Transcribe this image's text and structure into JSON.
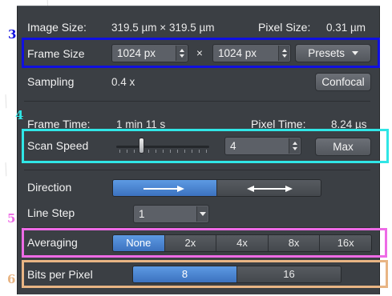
{
  "image_size": {
    "label": "Image Size:",
    "value": "319.5 µm × 319.5 µm"
  },
  "pixel_size": {
    "label": "Pixel Size:",
    "value": "0.31 µm"
  },
  "frame_size": {
    "label": "Frame Size",
    "width": "1024 px",
    "times": "×",
    "height": "1024 px",
    "presets_label": "Presets"
  },
  "sampling": {
    "label": "Sampling",
    "value": "0.4 x",
    "confocal_label": "Confocal"
  },
  "frame_time": {
    "label": "Frame Time:",
    "value": "1 min 11 s"
  },
  "pixel_time": {
    "label": "Pixel Time:",
    "value": "8.24 µs"
  },
  "scan_speed": {
    "label": "Scan Speed",
    "value": "4",
    "max_label": "Max",
    "slider_level": 4,
    "slider_max": 13
  },
  "direction": {
    "label": "Direction",
    "options": [
      "unidirectional",
      "bidirectional"
    ],
    "selected": "unidirectional"
  },
  "line_step": {
    "label": "Line Step",
    "value": "1"
  },
  "averaging": {
    "label": "Averaging",
    "options": [
      "None",
      "2x",
      "4x",
      "8x",
      "16x"
    ],
    "selected": "None"
  },
  "bits_per_pixel": {
    "label": "Bits per Pixel",
    "options": [
      "8",
      "16"
    ],
    "selected": "8"
  },
  "callouts": {
    "n3": "3",
    "n4": "4",
    "n5": "5",
    "n6": "6"
  },
  "colors": {
    "panel": "#3b3f44",
    "accent": "#4a85d4",
    "box3": "#1010e0",
    "box4": "#30e6e6",
    "box5": "#ee6be6",
    "box6": "#e8b584"
  }
}
